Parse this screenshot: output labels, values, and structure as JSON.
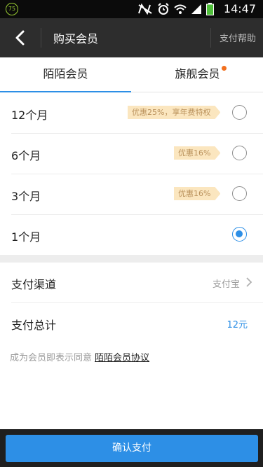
{
  "status_bar": {
    "badge": "75",
    "time": "14:47",
    "icons": [
      "nfc-off-icon",
      "alarm-icon",
      "wifi-icon",
      "signal-icon",
      "battery-icon"
    ]
  },
  "nav": {
    "title": "购买会员",
    "help_label": "支付帮助",
    "back_icon": "back-arrow-icon"
  },
  "tabs": [
    {
      "label": "陌陌会员",
      "active": true
    },
    {
      "label": "旗舰会员",
      "active": false,
      "has_dot": true
    }
  ],
  "plans": [
    {
      "label": "12个月",
      "discount": "优惠25%，享年费特权",
      "selected": false
    },
    {
      "label": "6个月",
      "discount": "优惠16%",
      "selected": false
    },
    {
      "label": "3个月",
      "discount": "优惠16%",
      "selected": false
    },
    {
      "label": "1个月",
      "discount": "",
      "selected": true
    }
  ],
  "payment": {
    "channel_label": "支付渠道",
    "channel_value": "支付宝",
    "total_label": "支付总计",
    "total_value": "12元"
  },
  "agreement": {
    "text": "成为会员即表示同意",
    "link": "陌陌会员协议"
  },
  "confirm_label": "确认支付",
  "colors": {
    "accent": "#2d8fe6",
    "navbar": "#2d2d2d",
    "badge_bg": "#fbe6bf",
    "badge_text": "#b9905a",
    "tab_dot": "#f2701e"
  }
}
